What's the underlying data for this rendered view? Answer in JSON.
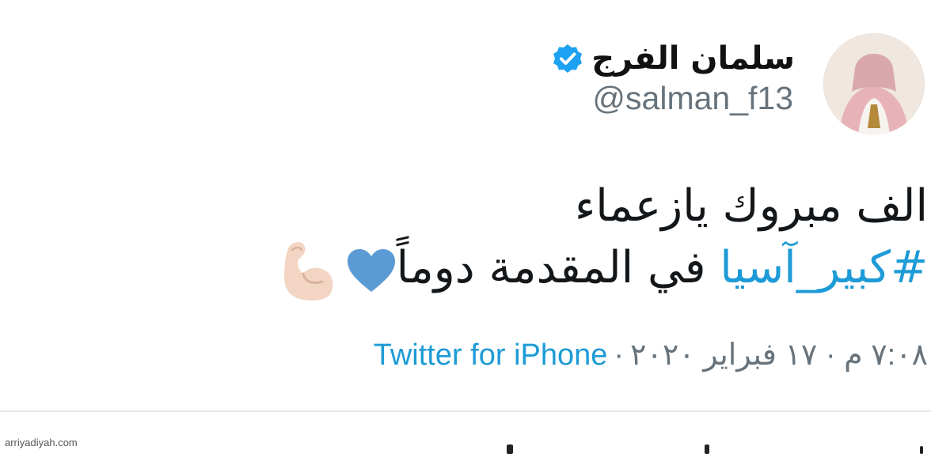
{
  "tweet": {
    "display_name": "سلمان الفرج",
    "handle": "@salman_f13",
    "text_line1": "الف مبروك يازعماء",
    "hashtag": "#كبير_آسيا",
    "text_line2_rest": " في المقدمة دوماً",
    "emojis": [
      "blue-heart-icon",
      "flexed-biceps-icon"
    ],
    "timestamp": "٧:٠٨ م · ١٧ فبراير ٢٠٢٠",
    "separator": "·",
    "source": "Twitter for iPhone"
  },
  "watermark": "arriyadiyah.com",
  "colors": {
    "hashtag": "#1d9bd6",
    "verified": "#1da1f2",
    "muted": "#67737c",
    "heart": "#5b9bd5"
  }
}
